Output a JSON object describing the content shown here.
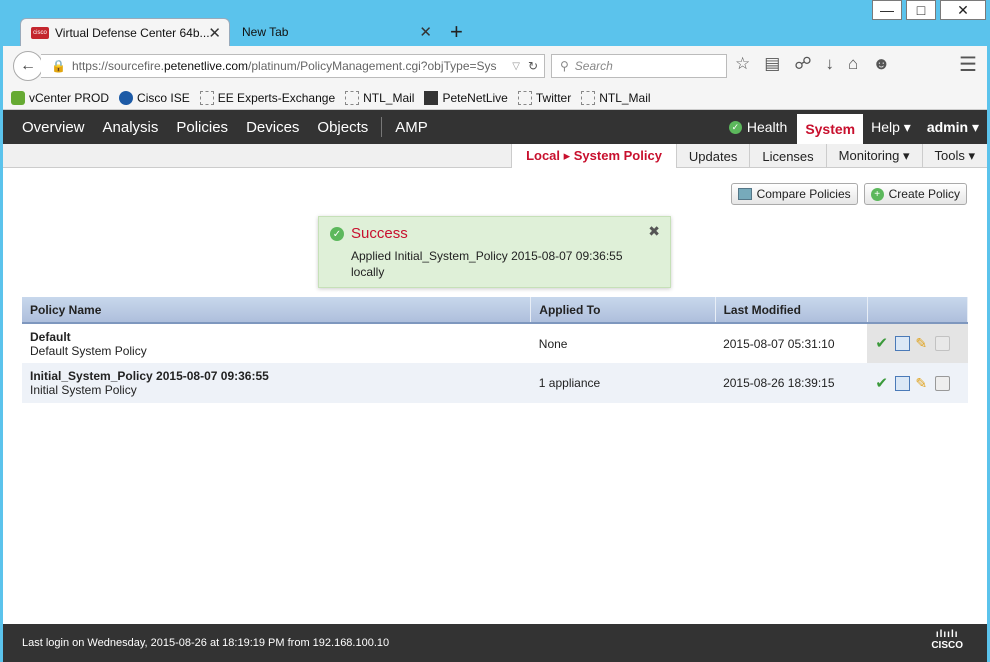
{
  "browser": {
    "tabs": [
      {
        "label": "Virtual Defense Center 64b..."
      },
      {
        "label": "New Tab"
      }
    ],
    "url": {
      "prefix": "https://sourcefire.",
      "domain": "petenetlive.com",
      "path": "/platinum/PolicyManagement.cgi?objType=Sys"
    },
    "search_placeholder": "Search",
    "bookmarks": [
      "vCenter PROD",
      "Cisco ISE",
      "EE Experts-Exchange",
      "NTL_Mail",
      "PeteNetLive",
      "Twitter",
      "NTL_Mail"
    ]
  },
  "topnav": {
    "items": [
      "Overview",
      "Analysis",
      "Policies",
      "Devices",
      "Objects",
      "AMP"
    ],
    "health": "Health",
    "system": "System",
    "help": "Help ▾",
    "admin": "admin ▾"
  },
  "subnav": {
    "active": "Local ▸ System Policy",
    "items": [
      "Updates",
      "Licenses",
      "Monitoring ▾",
      "Tools ▾"
    ]
  },
  "buttons": {
    "compare": "Compare Policies",
    "create": "Create Policy"
  },
  "alert": {
    "title": "Success",
    "message_line1": "Applied Initial_System_Policy 2015-08-07 09:36:55",
    "message_line2": "locally"
  },
  "table": {
    "headers": [
      "Policy Name",
      "Applied To",
      "Last Modified"
    ],
    "rows": [
      {
        "name": "Default",
        "description": "Default System Policy",
        "applied_to": "None",
        "modified": "2015-08-07 05:31:10"
      },
      {
        "name": "Initial_System_Policy 2015-08-07 09:36:55",
        "description": "Initial System Policy",
        "applied_to": "1 appliance",
        "modified": "2015-08-26 18:39:15"
      }
    ]
  },
  "footer": {
    "last_login": "Last login on Wednesday, 2015-08-26 at 18:19:19 PM from 192.168.100.10",
    "logo": "CISCO"
  },
  "colors": {
    "accent": "#c8102e",
    "nav": "#333333",
    "success_bg": "#dff0d8"
  }
}
